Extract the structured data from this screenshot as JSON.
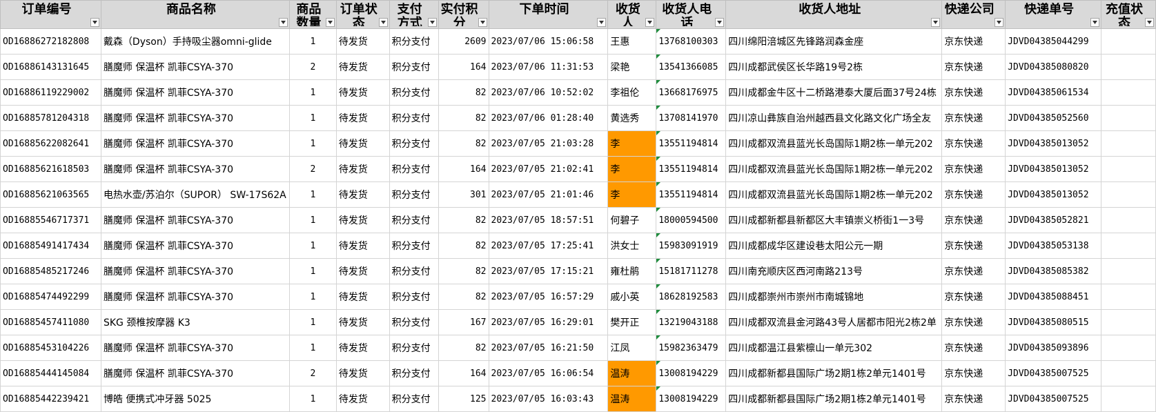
{
  "columns": [
    {
      "label": "订单编号"
    },
    {
      "label": "商品名称"
    },
    {
      "label": "商品数量"
    },
    {
      "label": "订单状态"
    },
    {
      "label": "支付方式"
    },
    {
      "label": "实付积分"
    },
    {
      "label": "下单时间"
    },
    {
      "label": "收货人"
    },
    {
      "label": "收货人电话"
    },
    {
      "label": "收货人地址"
    },
    {
      "label": "快递公司"
    },
    {
      "label": "快递单号"
    },
    {
      "label": "充值状态"
    }
  ],
  "highlight_color": "#ff9900",
  "rows": [
    {
      "order_id": "OD16886272182808",
      "product": "戴森（Dyson）手持吸尘器omni-glide",
      "qty": "1",
      "status": "待发货",
      "payment": "积分支付",
      "points": "2609",
      "time": "2023/07/06 15:06:58",
      "name": "王惠",
      "highlight": false,
      "phone": "13768100303",
      "address": "四川绵阳涪城区先锋路润森金座",
      "courier": "京东快递",
      "tracking": "JDVD04385044299",
      "recharge": ""
    },
    {
      "order_id": "OD16886143131645",
      "product": "膳魔师 保温杯 凯菲CSYA-370",
      "qty": "2",
      "status": "待发货",
      "payment": "积分支付",
      "points": "164",
      "time": "2023/07/06 11:31:53",
      "name": "梁艳",
      "highlight": false,
      "phone": "13541366085",
      "address": "四川成都武侯区长华路19号2栋",
      "courier": "京东快递",
      "tracking": "JDVD04385080820",
      "recharge": ""
    },
    {
      "order_id": "OD16886119229002",
      "product": "膳魔师 保温杯 凯菲CSYA-370",
      "qty": "1",
      "status": "待发货",
      "payment": "积分支付",
      "points": "82",
      "time": "2023/07/06 10:52:02",
      "name": "李祖伦",
      "highlight": false,
      "phone": "13668176975",
      "address": "四川成都金牛区十二桥路港泰大厦后面37号24栋",
      "courier": "京东快递",
      "tracking": "JDVD04385061534",
      "recharge": ""
    },
    {
      "order_id": "OD16885781204318",
      "product": "膳魔师 保温杯 凯菲CSYA-370",
      "qty": "1",
      "status": "待发货",
      "payment": "积分支付",
      "points": "82",
      "time": "2023/07/06 01:28:40",
      "name": "黄选秀",
      "highlight": false,
      "phone": "13708141970",
      "address": "四川凉山彝族自治州越西县文化路文化广场全友",
      "courier": "京东快递",
      "tracking": "JDVD04385052560",
      "recharge": ""
    },
    {
      "order_id": "OD16885622082641",
      "product": "膳魔师 保温杯 凯菲CSYA-370",
      "qty": "1",
      "status": "待发货",
      "payment": "积分支付",
      "points": "82",
      "time": "2023/07/05 21:03:28",
      "name": "李",
      "highlight": true,
      "phone": "13551194814",
      "address": "四川成都双流县蓝光长岛国际1期2栋一单元202",
      "courier": "京东快递",
      "tracking": "JDVD04385013052",
      "recharge": ""
    },
    {
      "order_id": "OD16885621618503",
      "product": "膳魔师 保温杯 凯菲CSYA-370",
      "qty": "2",
      "status": "待发货",
      "payment": "积分支付",
      "points": "164",
      "time": "2023/07/05 21:02:41",
      "name": "李",
      "highlight": true,
      "phone": "13551194814",
      "address": "四川成都双流县蓝光长岛国际1期2栋一单元202",
      "courier": "京东快递",
      "tracking": "JDVD04385013052",
      "recharge": ""
    },
    {
      "order_id": "OD16885621063565",
      "product": "电热水壶/苏泊尔（SUPOR） SW-17S62A",
      "qty": "1",
      "status": "待发货",
      "payment": "积分支付",
      "points": "301",
      "time": "2023/07/05 21:01:46",
      "name": "李",
      "highlight": true,
      "phone": "13551194814",
      "address": "四川成都双流县蓝光长岛国际1期2栋一单元202",
      "courier": "京东快递",
      "tracking": "JDVD04385013052",
      "recharge": ""
    },
    {
      "order_id": "OD16885546717371",
      "product": "膳魔师 保温杯 凯菲CSYA-370",
      "qty": "1",
      "status": "待发货",
      "payment": "积分支付",
      "points": "82",
      "time": "2023/07/05 18:57:51",
      "name": "何碧子",
      "highlight": false,
      "phone": "18000594500",
      "address": "四川成都新都县新都区大丰镇崇义桥街1一3号",
      "courier": "京东快递",
      "tracking": "JDVD04385052821",
      "recharge": ""
    },
    {
      "order_id": "OD16885491417434",
      "product": "膳魔师 保温杯 凯菲CSYA-370",
      "qty": "1",
      "status": "待发货",
      "payment": "积分支付",
      "points": "82",
      "time": "2023/07/05 17:25:41",
      "name": "洪女士",
      "highlight": false,
      "phone": "15983091919",
      "address": "四川成都成华区建设巷太阳公元一期",
      "courier": "京东快递",
      "tracking": "JDVD04385053138",
      "recharge": ""
    },
    {
      "order_id": "OD16885485217246",
      "product": "膳魔师 保温杯 凯菲CSYA-370",
      "qty": "1",
      "status": "待发货",
      "payment": "积分支付",
      "points": "82",
      "time": "2023/07/05 17:15:21",
      "name": "雍杜鹃",
      "highlight": false,
      "phone": "15181711278",
      "address": "四川南充顺庆区西河南路213号",
      "courier": "京东快递",
      "tracking": "JDVD04385085382",
      "recharge": ""
    },
    {
      "order_id": "OD16885474492299",
      "product": "膳魔师 保温杯 凯菲CSYA-370",
      "qty": "1",
      "status": "待发货",
      "payment": "积分支付",
      "points": "82",
      "time": "2023/07/05 16:57:29",
      "name": "戚小英",
      "highlight": false,
      "phone": "18628192583",
      "address": "四川成都崇州市崇州市南城锦地",
      "courier": "京东快递",
      "tracking": "JDVD04385088451",
      "recharge": ""
    },
    {
      "order_id": "OD16885457411080",
      "product": "SKG 颈椎按摩器 K3",
      "qty": "1",
      "status": "待发货",
      "payment": "积分支付",
      "points": "167",
      "time": "2023/07/05 16:29:01",
      "name": "樊开正",
      "highlight": false,
      "phone": "13219043188",
      "address": "四川成都双流县金河路43号人居都市阳光2栋2单",
      "courier": "京东快递",
      "tracking": "JDVD04385080515",
      "recharge": ""
    },
    {
      "order_id": "OD16885453104226",
      "product": "膳魔师 保温杯 凯菲CSYA-370",
      "qty": "1",
      "status": "待发货",
      "payment": "积分支付",
      "points": "82",
      "time": "2023/07/05 16:21:50",
      "name": "江凤",
      "highlight": false,
      "phone": "15982363479",
      "address": "四川成都温江县紫檩山一单元302",
      "courier": "京东快递",
      "tracking": "JDVD04385093896",
      "recharge": ""
    },
    {
      "order_id": "OD16885444145084",
      "product": "膳魔师 保温杯 凯菲CSYA-370",
      "qty": "2",
      "status": "待发货",
      "payment": "积分支付",
      "points": "164",
      "time": "2023/07/05 16:06:54",
      "name": "温涛",
      "highlight": true,
      "phone": "13008194229",
      "address": "四川成都新都县国际广场2期1栋2单元1401号",
      "courier": "京东快递",
      "tracking": "JDVD04385007525",
      "recharge": ""
    },
    {
      "order_id": "OD16885442239421",
      "product": "博皓 便携式冲牙器 5025",
      "qty": "1",
      "status": "待发货",
      "payment": "积分支付",
      "points": "125",
      "time": "2023/07/05 16:03:43",
      "name": "温涛",
      "highlight": true,
      "phone": "13008194229",
      "address": "四川成都新都县国际广场2期1栋2单元1401号",
      "courier": "京东快递",
      "tracking": "JDVD04385007525",
      "recharge": ""
    }
  ]
}
